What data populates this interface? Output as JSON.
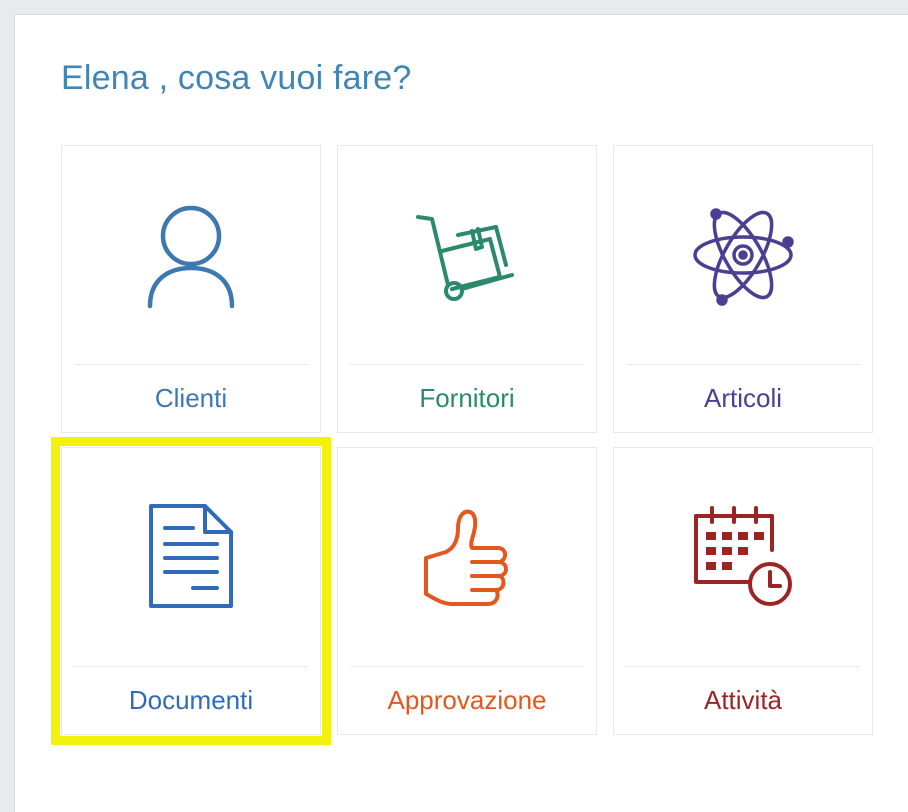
{
  "greeting": "Elena , cosa vuoi fare?",
  "colors": {
    "greeting": "#3f86b6",
    "highlight": "#f3f20c"
  },
  "tiles": [
    {
      "label": "Clienti",
      "icon": "person-icon",
      "color": "#3d78b0"
    },
    {
      "label": "Fornitori",
      "icon": "hand-truck-icon",
      "color": "#2a8a6b"
    },
    {
      "label": "Articoli",
      "icon": "atom-icon",
      "color": "#4a3f93"
    },
    {
      "label": "Documenti",
      "icon": "document-icon",
      "color": "#2f6bb8",
      "highlighted": true
    },
    {
      "label": "Approvazione",
      "icon": "thumbs-up-icon",
      "color": "#e3581c"
    },
    {
      "label": "Attività",
      "icon": "calendar-clock-icon",
      "color": "#9d2424"
    }
  ]
}
